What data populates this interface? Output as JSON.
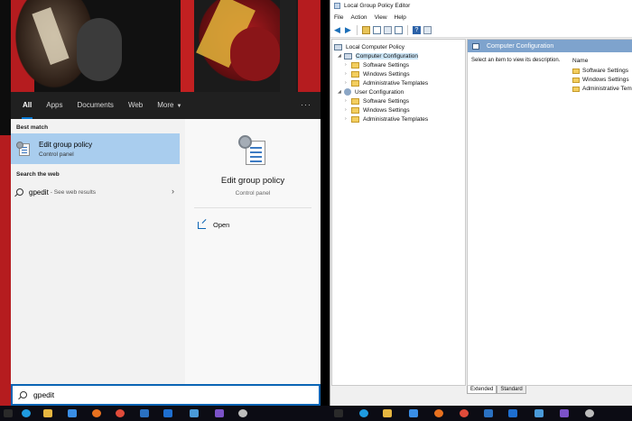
{
  "start_menu": {
    "tabs": [
      {
        "label": "All",
        "active": true
      },
      {
        "label": "Apps"
      },
      {
        "label": "Documents"
      },
      {
        "label": "Web"
      },
      {
        "label": "More"
      }
    ],
    "more_icon": "ellipsis-icon",
    "best_match_label": "Best match",
    "best_match": {
      "title": "Edit group policy",
      "subtitle": "Control panel",
      "icon": "group-policy-icon"
    },
    "search_web_label": "Search the web",
    "web_result": {
      "query": "gpedit",
      "suffix": "- See web results",
      "icon": "search-icon"
    },
    "detail": {
      "title": "Edit group policy",
      "subtitle": "Control panel",
      "open_label": "Open"
    },
    "search_box": {
      "value": "gpedit"
    }
  },
  "gpe": {
    "title": "Local Group Policy Editor",
    "menu": [
      "File",
      "Action",
      "View",
      "Help"
    ],
    "tree": {
      "root": "Local Computer Policy",
      "computer_config": "Computer Configuration",
      "computer_children": [
        "Software Settings",
        "Windows Settings",
        "Administrative Templates"
      ],
      "user_config": "User Configuration",
      "user_children": [
        "Software Settings",
        "Windows Settings",
        "Administrative Templates"
      ]
    },
    "content": {
      "header": "Computer Configuration",
      "description": "Select an item to view its description.",
      "name_column": "Name",
      "items": [
        "Software Settings",
        "Windows Settings",
        "Administrative Tem"
      ]
    },
    "bottom_tabs": [
      "Extended",
      "Standard"
    ]
  },
  "colors": {
    "accent": "#0a64b4",
    "selection": "#a9cdee",
    "header_bar": "#7ea3cd",
    "folder": "#f3ce5f"
  }
}
